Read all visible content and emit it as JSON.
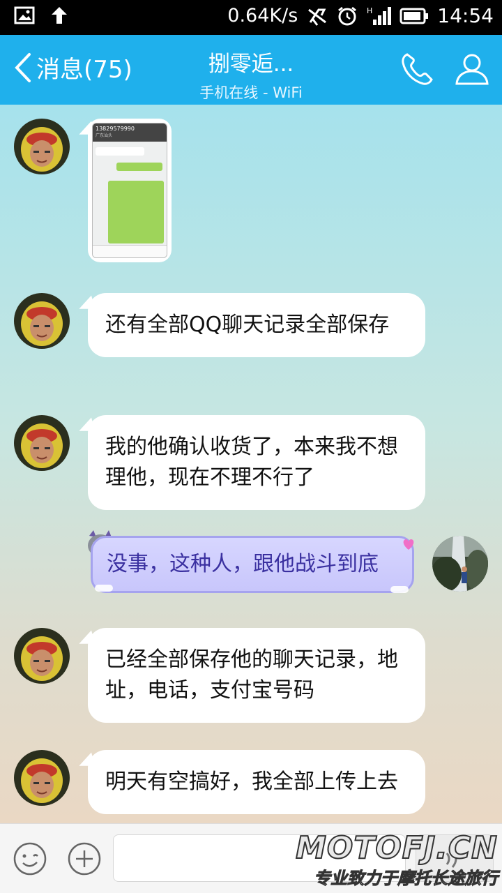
{
  "status_bar": {
    "speed": "0.64K/s",
    "time": "14:54"
  },
  "header": {
    "back_label": "消息(75)",
    "title": "捌零逅...",
    "subtitle": "手机在线 - WiFi"
  },
  "messages": [
    {
      "side": "left",
      "type": "image"
    },
    {
      "side": "left",
      "type": "text",
      "text": "还有全部QQ聊天记录全部保存"
    },
    {
      "side": "left",
      "type": "text",
      "text": "我的他确认收货了，本来我不想理他，现在不理不行了"
    },
    {
      "side": "right",
      "type": "text",
      "text": "没事，这种人，跟他战斗到底"
    },
    {
      "side": "left",
      "type": "text",
      "text": "已经全部保存他的聊天记录，地址，电话，支付宝号码"
    },
    {
      "side": "left",
      "type": "text",
      "text": "明天有空搞好，我全部上传上去"
    }
  ],
  "screenshot_thumb": {
    "number": "13829579990",
    "location": "广东汕头"
  },
  "watermark": {
    "brand": "MOTOFJ.CN",
    "tagline": "专业致力于摩托长途旅行"
  },
  "colors": {
    "header_bg": "#1fb0ec",
    "right_bubble": "#c8c6fb"
  }
}
